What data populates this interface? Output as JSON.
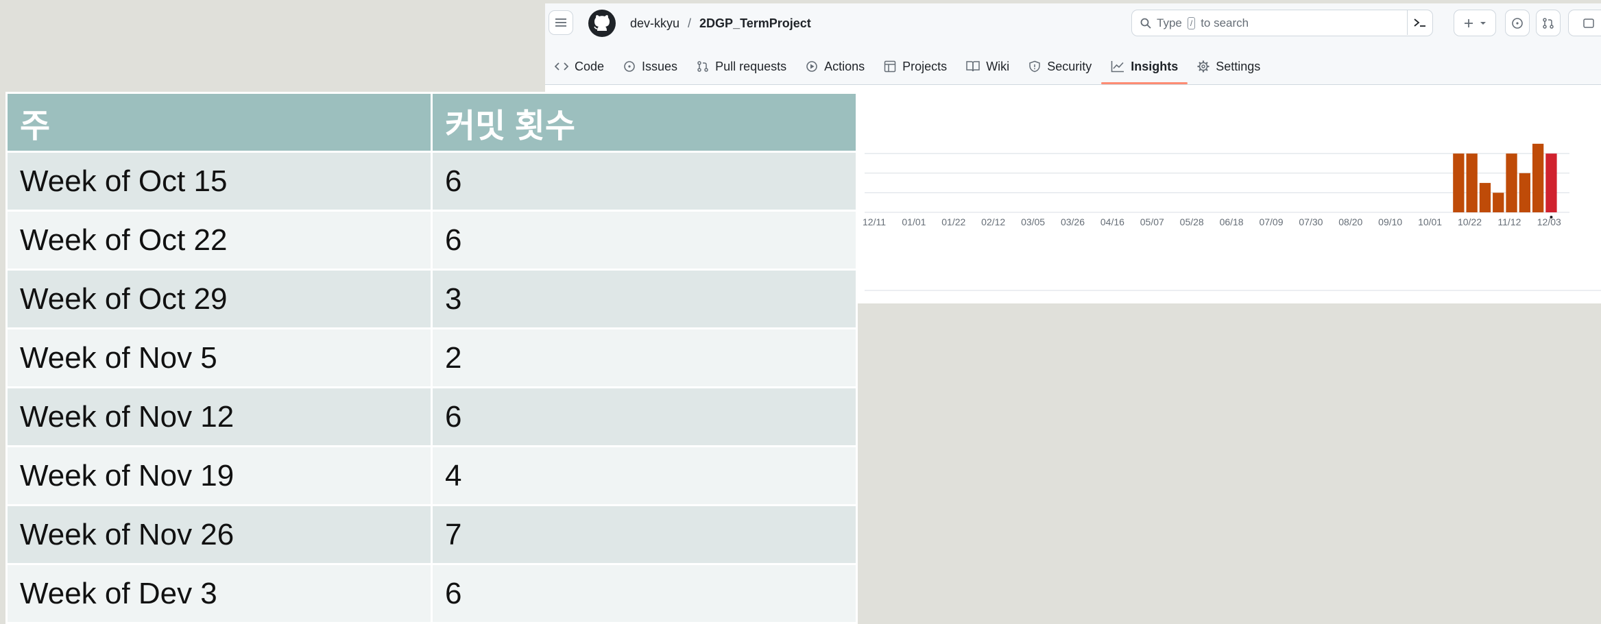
{
  "header": {
    "owner": "dev-kkyu",
    "separator": "/",
    "repo": "2DGP_TermProject",
    "search_placeholder_pre": "Type",
    "search_key": "/",
    "search_placeholder_post": "to search"
  },
  "tabs": [
    {
      "label": "Code",
      "icon": "code-icon"
    },
    {
      "label": "Issues",
      "icon": "issue-icon"
    },
    {
      "label": "Pull requests",
      "icon": "pull-request-icon"
    },
    {
      "label": "Actions",
      "icon": "play-icon"
    },
    {
      "label": "Projects",
      "icon": "table-icon"
    },
    {
      "label": "Wiki",
      "icon": "book-icon"
    },
    {
      "label": "Security",
      "icon": "shield-icon"
    },
    {
      "label": "Insights",
      "icon": "graph-icon",
      "active": true
    },
    {
      "label": "Settings",
      "icon": "gear-icon"
    }
  ],
  "table": {
    "headers": [
      "주",
      "커밋 횟수"
    ],
    "rows": [
      [
        "Week of Oct 15",
        "6"
      ],
      [
        "Week of Oct 22",
        "6"
      ],
      [
        "Week of Oct 29",
        "3"
      ],
      [
        "Week of Nov 5",
        "2"
      ],
      [
        "Week of Nov 12",
        "6"
      ],
      [
        "Week of Nov 19",
        "4"
      ],
      [
        "Week of Nov 26",
        "7"
      ],
      [
        "Week of Dev 3",
        "6"
      ]
    ]
  },
  "chart_data": {
    "type": "bar",
    "x_tick_labels": [
      "12/11",
      "01/01",
      "01/22",
      "02/12",
      "03/05",
      "03/26",
      "04/16",
      "05/07",
      "05/28",
      "06/18",
      "07/09",
      "07/30",
      "08/20",
      "09/10",
      "10/01",
      "10/22",
      "11/12",
      "12/03"
    ],
    "y_ticks": [
      0,
      2,
      4,
      6
    ],
    "ylim": [
      0,
      7.2
    ],
    "weeks_total": 53,
    "bars": [
      {
        "week_index": 44,
        "value": 6
      },
      {
        "week_index": 45,
        "value": 6
      },
      {
        "week_index": 46,
        "value": 3
      },
      {
        "week_index": 47,
        "value": 2
      },
      {
        "week_index": 48,
        "value": 6
      },
      {
        "week_index": 49,
        "value": 4
      },
      {
        "week_index": 50,
        "value": 7
      },
      {
        "week_index": 51,
        "value": 6,
        "highlight": true
      }
    ],
    "second_chart_y_tick": "5",
    "colors": {
      "bar": "#bf4b08",
      "highlight": "#d0222e",
      "grid": "#d8dee4",
      "tick": "#656d76"
    }
  }
}
